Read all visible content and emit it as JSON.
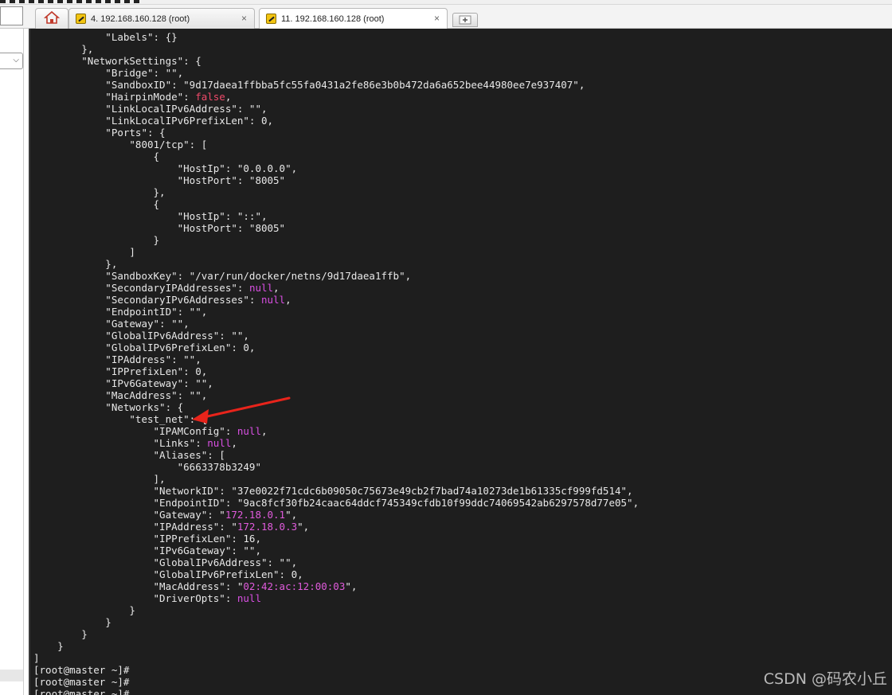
{
  "tabs": [
    {
      "label": "4. 192.168.160.128 (root)",
      "close": "×",
      "active": false
    },
    {
      "label": "11. 192.168.160.128 (root)",
      "close": "×",
      "active": true
    }
  ],
  "icons": {
    "home": "home-icon",
    "tab": "terminal-session-icon",
    "new_tab": "new-tab-icon",
    "dropdown": "chevron-down-icon"
  },
  "sidebar": {
    "dropdown_chevron": "⌵"
  },
  "terminal": {
    "lines": [
      "            \"Labels\": {}",
      "        },",
      "        \"NetworkSettings\": {",
      "            \"Bridge\": \"\",",
      "            \"SandboxID\": \"9d17daea1ffbba5fc55fa0431a2fe86e3b0b472da6a652bee44980ee7e937407\",",
      "            \"HairpinMode\": false,",
      "            \"LinkLocalIPv6Address\": \"\",",
      "            \"LinkLocalIPv6PrefixLen\": 0,",
      "            \"Ports\": {",
      "                \"8001/tcp\": [",
      "                    {",
      "                        \"HostIp\": \"0.0.0.0\",",
      "                        \"HostPort\": \"8005\"",
      "                    },",
      "                    {",
      "                        \"HostIp\": \"::\",",
      "                        \"HostPort\": \"8005\"",
      "                    }",
      "                ]",
      "            },",
      "            \"SandboxKey\": \"/var/run/docker/netns/9d17daea1ffb\",",
      "            \"SecondaryIPAddresses\": null,",
      "            \"SecondaryIPv6Addresses\": null,",
      "            \"EndpointID\": \"\",",
      "            \"Gateway\": \"\",",
      "            \"GlobalIPv6Address\": \"\",",
      "            \"GlobalIPv6PrefixLen\": 0,",
      "            \"IPAddress\": \"\",",
      "            \"IPPrefixLen\": 0,",
      "            \"IPv6Gateway\": \"\",",
      "            \"MacAddress\": \"\",",
      "            \"Networks\": {",
      "                \"test_net\": {",
      "                    \"IPAMConfig\": null,",
      "                    \"Links\": null,",
      "                    \"Aliases\": [",
      "                        \"6663378b3249\"",
      "                    ],",
      "                    \"NetworkID\": \"37e0022f71cdc6b09050c75673e49cb2f7bad74a10273de1b61335cf999fd514\",",
      "                    \"EndpointID\": \"9ac8fcf30fb24caac64ddcf745349cfdb10f99ddc74069542ab6297578d77e05\",",
      "                    \"Gateway\": \"172.18.0.1\",",
      "                    \"IPAddress\": \"172.18.0.3\",",
      "                    \"IPPrefixLen\": 16,",
      "                    \"IPv6Gateway\": \"\",",
      "                    \"GlobalIPv6Address\": \"\",",
      "                    \"GlobalIPv6PrefixLen\": 0,",
      "                    \"MacAddress\": \"02:42:ac:12:00:03\",",
      "                    \"DriverOpts\": null",
      "                }",
      "            }",
      "        }",
      "    }",
      "]",
      "[root@master ~]#",
      "[root@master ~]#",
      "[root@master ~]#"
    ],
    "highlights": [
      {
        "text": "false",
        "color": "#f04a6a"
      },
      {
        "text": "null",
        "color": "#d94fe3"
      },
      {
        "text": "172.18.0.1",
        "color": "#e05bdc"
      },
      {
        "text": "172.18.0.3",
        "color": "#e05bdc"
      },
      {
        "text": "02:42:ac:12:00:03",
        "color": "#e05bdc"
      }
    ]
  },
  "annotation": {
    "arrow_color": "#e8241b"
  },
  "watermark": "CSDN @码农小丘"
}
